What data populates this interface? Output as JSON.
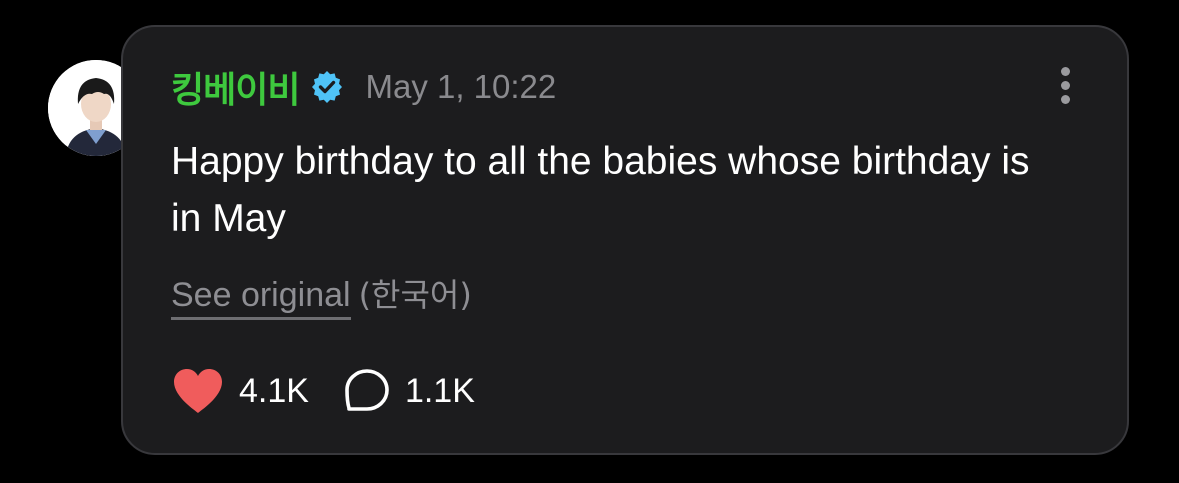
{
  "post": {
    "author": "킹베이비",
    "timestamp": "May 1, 10:22",
    "text": "Happy birthday to all the babies whose birthday is in May",
    "see_original_label": "See original",
    "original_language": "(한국어)",
    "likes": "4.1K",
    "comments": "1.1K"
  },
  "icons": {
    "verified": "verified-badge-icon",
    "more": "more-vertical-icon",
    "like": "heart-icon",
    "comment": "comment-bubble-icon"
  },
  "colors": {
    "author": "#3ec93e",
    "verified_badge": "#4fc3f7",
    "heart": "#f05c5c",
    "card_background": "#1c1c1e",
    "page_background": "#000000"
  }
}
